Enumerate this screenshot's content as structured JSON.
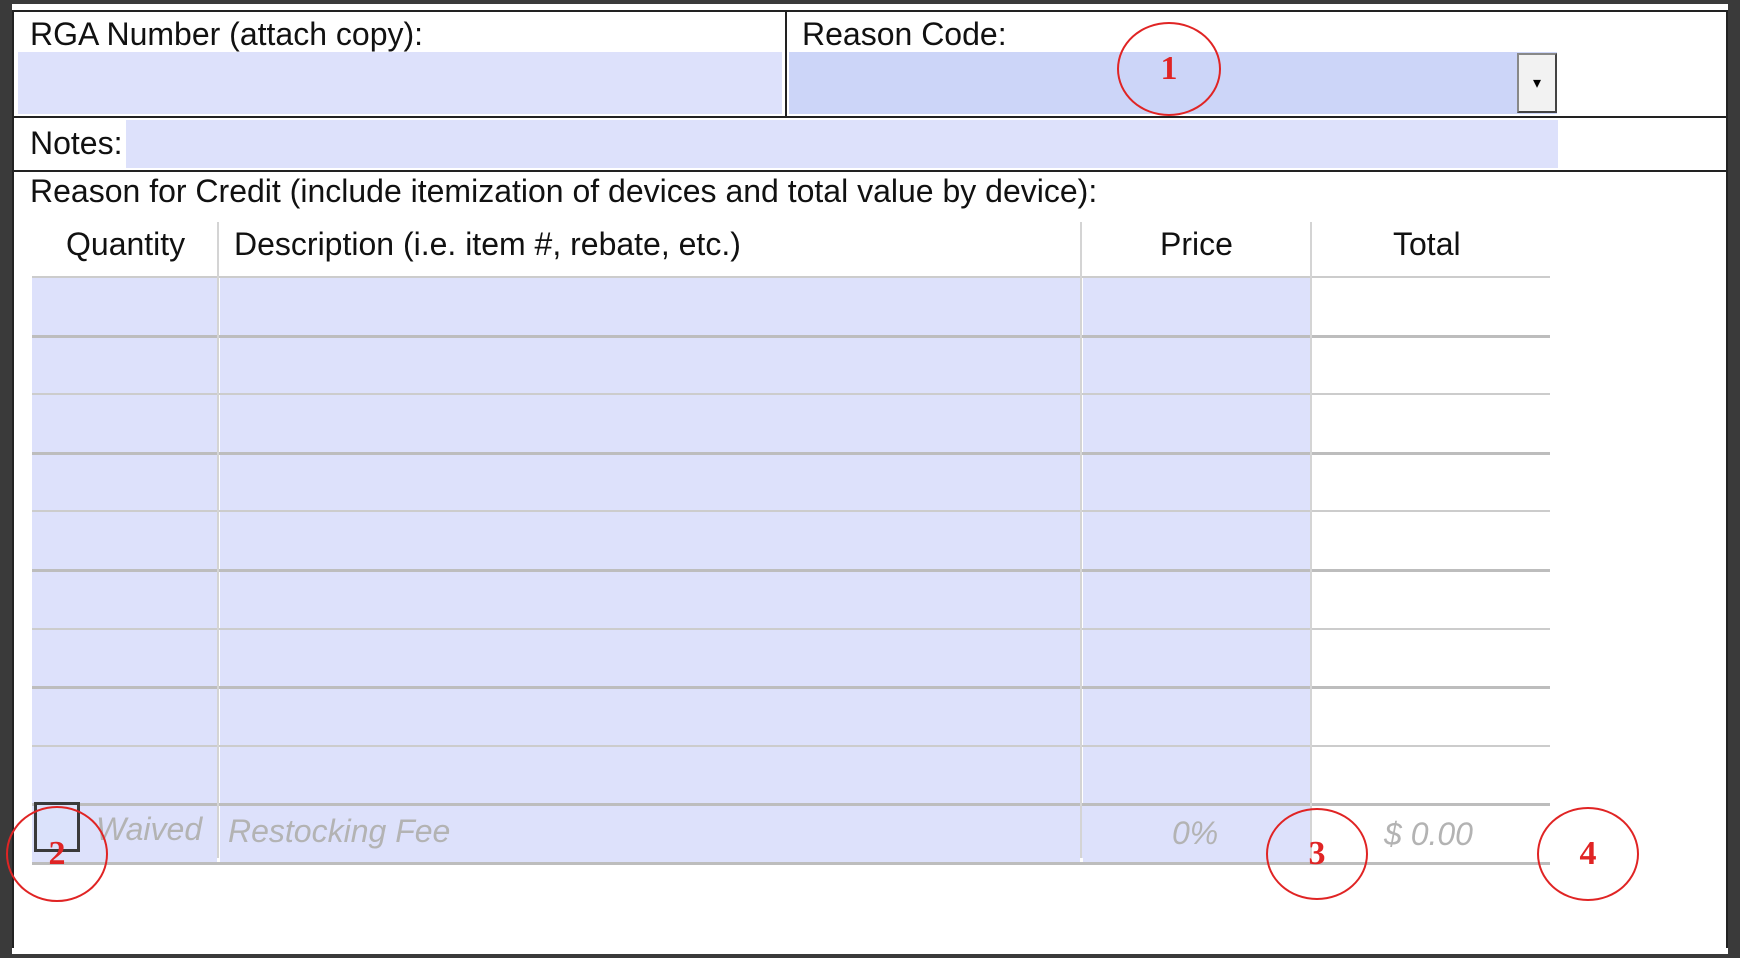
{
  "form": {
    "rga_label": "RGA Number (attach copy):",
    "rga_value": "",
    "reason_code_label": "Reason Code:",
    "reason_code_value": "",
    "dropdown_icon": "▾",
    "notes_label": "Notes:",
    "notes_value": "",
    "reason_for_credit_label": "Reason for Credit (include itemization of devices and total value by device):"
  },
  "table": {
    "headers": {
      "quantity": "Quantity",
      "description": "Description (i.e. item #, rebate, etc.)",
      "price": "Price",
      "total": "Total"
    },
    "rows": [
      {
        "quantity": "",
        "description": "",
        "price": "",
        "total": ""
      },
      {
        "quantity": "",
        "description": "",
        "price": "",
        "total": ""
      },
      {
        "quantity": "",
        "description": "",
        "price": "",
        "total": ""
      },
      {
        "quantity": "",
        "description": "",
        "price": "",
        "total": ""
      },
      {
        "quantity": "",
        "description": "",
        "price": "",
        "total": ""
      },
      {
        "quantity": "",
        "description": "",
        "price": "",
        "total": ""
      },
      {
        "quantity": "",
        "description": "",
        "price": "",
        "total": ""
      },
      {
        "quantity": "",
        "description": "",
        "price": "",
        "total": ""
      },
      {
        "quantity": "",
        "description": "",
        "price": "",
        "total": ""
      },
      {
        "quantity": "",
        "description": "",
        "price": "",
        "total": ""
      }
    ],
    "fee_row": {
      "waived_label": "Waived",
      "description": "Restocking Fee",
      "percent": "0%",
      "total": "$ 0.00"
    }
  },
  "callouts": [
    "1",
    "2",
    "3",
    "4"
  ],
  "colors": {
    "field_fill": "#dde1fb",
    "callout": "#e02424"
  }
}
